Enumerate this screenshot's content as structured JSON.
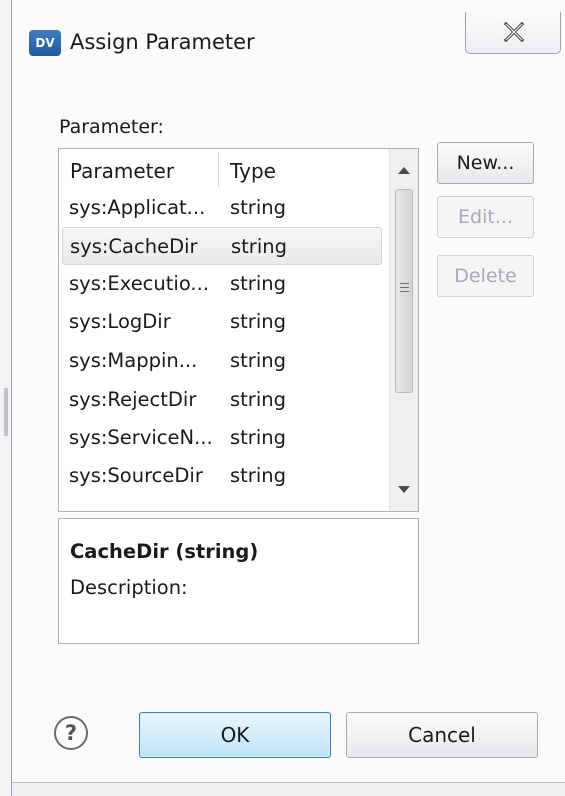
{
  "window": {
    "title": "Assign Parameter",
    "app_icon_text": "DV"
  },
  "section_label": "Parameter:",
  "table": {
    "columns": [
      "Parameter",
      "Type"
    ],
    "rows": [
      {
        "name": "sys:Applicat...",
        "type": "string"
      },
      {
        "name": "sys:CacheDir",
        "type": "string"
      },
      {
        "name": "sys:Executio...",
        "type": "string"
      },
      {
        "name": "sys:LogDir",
        "type": "string"
      },
      {
        "name": "sys:Mappin...",
        "type": "string"
      },
      {
        "name": "sys:RejectDir",
        "type": "string"
      },
      {
        "name": "sys:ServiceN...",
        "type": "string"
      },
      {
        "name": "sys:SourceDir",
        "type": "string"
      }
    ],
    "selected_row": "sys:CacheDir"
  },
  "buttons": {
    "new": "New...",
    "edit": "Edit...",
    "delete": "Delete",
    "ok": "OK",
    "cancel": "Cancel",
    "help": "?"
  },
  "description": {
    "title": "CacheDir (string)",
    "label": "Description:"
  },
  "colors": {
    "ok_button": "#bfe3f7",
    "disabled_text": "#a6a9ad"
  },
  "icons": [
    "close-icon",
    "scroll-up-icon",
    "scroll-down-icon",
    "help-icon",
    "app-icon"
  ]
}
